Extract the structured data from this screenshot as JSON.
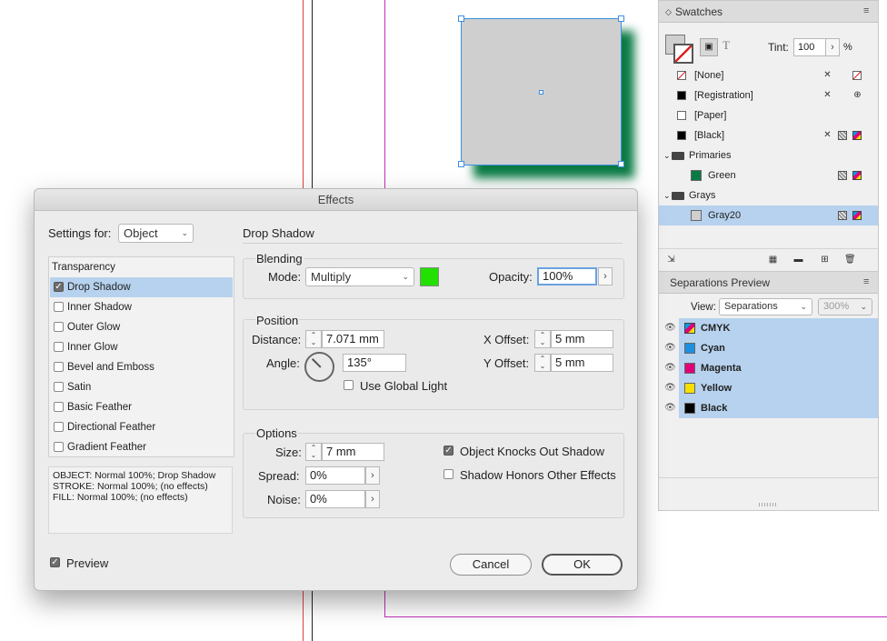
{
  "canvas": {
    "accent": "#3d8fe0",
    "shadow_color": "#0a7a44"
  },
  "swatches": {
    "title": "Swatches",
    "tint_label": "Tint:",
    "tint_value": "100",
    "tint_unit": "%",
    "items": [
      {
        "name": "[None]"
      },
      {
        "name": "[Registration]"
      },
      {
        "name": "[Paper]"
      },
      {
        "name": "[Black]"
      },
      {
        "name": "Primaries"
      },
      {
        "name": "Green"
      },
      {
        "name": "Grays"
      },
      {
        "name": "Gray20"
      }
    ]
  },
  "separations": {
    "title": "Separations Preview",
    "view_label": "View:",
    "view_value": "Separations",
    "zoom_value": "300%",
    "inks": [
      {
        "name": "CMYK"
      },
      {
        "name": "Cyan",
        "color": "#1e8fe0"
      },
      {
        "name": "Magenta",
        "color": "#e0007a"
      },
      {
        "name": "Yellow",
        "color": "#f5e000"
      },
      {
        "name": "Black",
        "color": "#000000"
      }
    ]
  },
  "dialog": {
    "title": "Effects",
    "settings_for_label": "Settings for:",
    "settings_for_value": "Object",
    "section_title": "Drop Shadow",
    "effects_list": {
      "header": "Transparency",
      "items": [
        {
          "label": "Drop Shadow",
          "checked": true
        },
        {
          "label": "Inner Shadow",
          "checked": false
        },
        {
          "label": "Outer Glow",
          "checked": false
        },
        {
          "label": "Inner Glow",
          "checked": false
        },
        {
          "label": "Bevel and Emboss",
          "checked": false
        },
        {
          "label": "Satin",
          "checked": false
        },
        {
          "label": "Basic Feather",
          "checked": false
        },
        {
          "label": "Directional Feather",
          "checked": false
        },
        {
          "label": "Gradient Feather",
          "checked": false
        }
      ]
    },
    "summary": {
      "line1": "OBJECT: Normal 100%; Drop Shadow",
      "line2": "STROKE: Normal 100%; (no effects)",
      "line3": "FILL: Normal 100%; (no effects)"
    },
    "blending": {
      "legend": "Blending",
      "mode_label": "Mode:",
      "mode_value": "Multiply",
      "color": "#22e000",
      "opacity_label": "Opacity:",
      "opacity_value": "100%"
    },
    "position": {
      "legend": "Position",
      "distance_label": "Distance:",
      "distance_value": "7.071 mm",
      "angle_label": "Angle:",
      "angle_value": "135°",
      "global_light_label": "Use Global Light",
      "x_offset_label": "X Offset:",
      "x_offset_value": "5 mm",
      "y_offset_label": "Y Offset:",
      "y_offset_value": "5 mm"
    },
    "options": {
      "legend": "Options",
      "size_label": "Size:",
      "size_value": "7 mm",
      "spread_label": "Spread:",
      "spread_value": "0%",
      "noise_label": "Noise:",
      "noise_value": "0%",
      "knocks_out_label": "Object Knocks Out Shadow",
      "honors_label": "Shadow Honors Other Effects"
    },
    "preview_label": "Preview",
    "cancel_label": "Cancel",
    "ok_label": "OK"
  }
}
